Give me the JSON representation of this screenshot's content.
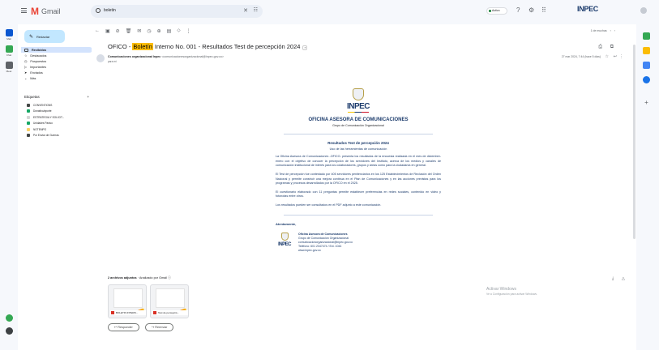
{
  "app": {
    "name": "Gmail",
    "brand": "INPEC"
  },
  "search": {
    "value": "boletin"
  },
  "status": {
    "label": "Activo"
  },
  "compose": {
    "label": "Redactar"
  },
  "rail": [
    {
      "label": "Mail",
      "color": "#0b57d0"
    },
    {
      "label": "Chat",
      "color": "#34a853"
    },
    {
      "label": "Meet",
      "color": "#5f6368"
    }
  ],
  "nav": [
    {
      "label": "Recibidos"
    },
    {
      "label": "Destacados"
    },
    {
      "label": "Pospuestos"
    },
    {
      "label": "Importantes"
    },
    {
      "label": "Enviados"
    },
    {
      "label": "Más"
    }
  ],
  "labels": {
    "title": "Etiquetas",
    "add": "+",
    "items": [
      {
        "label": "CONVENTIONS",
        "color": "#444746"
      },
      {
        "label": "Donativo/aporte",
        "color": "#16a765"
      },
      {
        "label": "ESTRATEGIA Y SOLICIT...",
        "color": "#d5d5d5"
      },
      {
        "label": "Unidades Pasivo",
        "color": "#16a765"
      },
      {
        "label": "NOTEMPO",
        "color": "#fad165"
      },
      {
        "label": "Por Enviar de Guerras",
        "color": "#444746"
      }
    ]
  },
  "pager": {
    "range": "1 de muchas",
    "prev": "‹",
    "next": "›"
  },
  "email": {
    "subject_pre": "OFICO - ",
    "subject_highlight": "Boletín",
    "subject_post": " Interno No. 001 - Resultados Test de percepción 2024",
    "tag": "»",
    "sender": "Comunicaciones organizacional Inpec",
    "sender_addr": "<comunicacionesorganizacional@inpec.gov.co>",
    "to": "para mí",
    "date": "27 mar 2024, 7:44 (hace 5 días)"
  },
  "body": {
    "logo_text": "INPEC",
    "office": "OFICINA ASESORA DE COMUNICACIONES",
    "grupo": "Grupo de Comunicación Organizacional",
    "results_title": "Resultados Test de percepción 2024",
    "results_sub": "Uso de las herramientas de comunicación",
    "paragraphs": [
      "La Oficina Asesora de Comunicaciones -OFICO- presenta los resultados de la encuesta realizada en el mes de diciembre-enero con el objetivo de conocer la percepción de los servidores del Instituto, acerca de los medios y canales de comunicación institucional de interés para los colaboradores, grupos y áreas como para la ciudadanía en general.",
      "El Test de percepción fue contestado por 405 servidores penitenciarios en los 125 Establecimientos de Reclusión del Orden Nacional y permite construir una mejora continua en el Plan de Comunicaciones y en las acciones previstas para los programas y procesos desarrollados por la OFICO en el 2025.",
      "El cuestionario elaborado con 11 preguntas permite establecer preferencias en redes sociales, contenido en video y fotonotas entre otros.",
      "Los resultados pueden ser consultados en el PDF adjunto a este comunicación."
    ],
    "greeting": "Atentamente,",
    "signature": {
      "name": "Oficina Asesora de Comunicaciones",
      "group": "Grupo de Comunicación Organizacional",
      "email": "comunicacionorganizacional@inpec.gov.co",
      "phone": "Teléfono: 601 2347474 / Ext. 1044",
      "web": "www.inpec.gov.co"
    }
  },
  "attachments": {
    "header_bold": "2 archivos adjuntos",
    "header_rest": " · Analizado por Gmail ⓘ",
    "files": [
      {
        "name": "BOLETIN INTERN..."
      },
      {
        "name": "Test de percepció..."
      }
    ]
  },
  "actions": {
    "reply": "↩ Responder",
    "forward": "↪ Reenviar"
  },
  "watermark": {
    "line1": "Activar Windows",
    "line2": "Ve a Configuración para activar Windows."
  }
}
